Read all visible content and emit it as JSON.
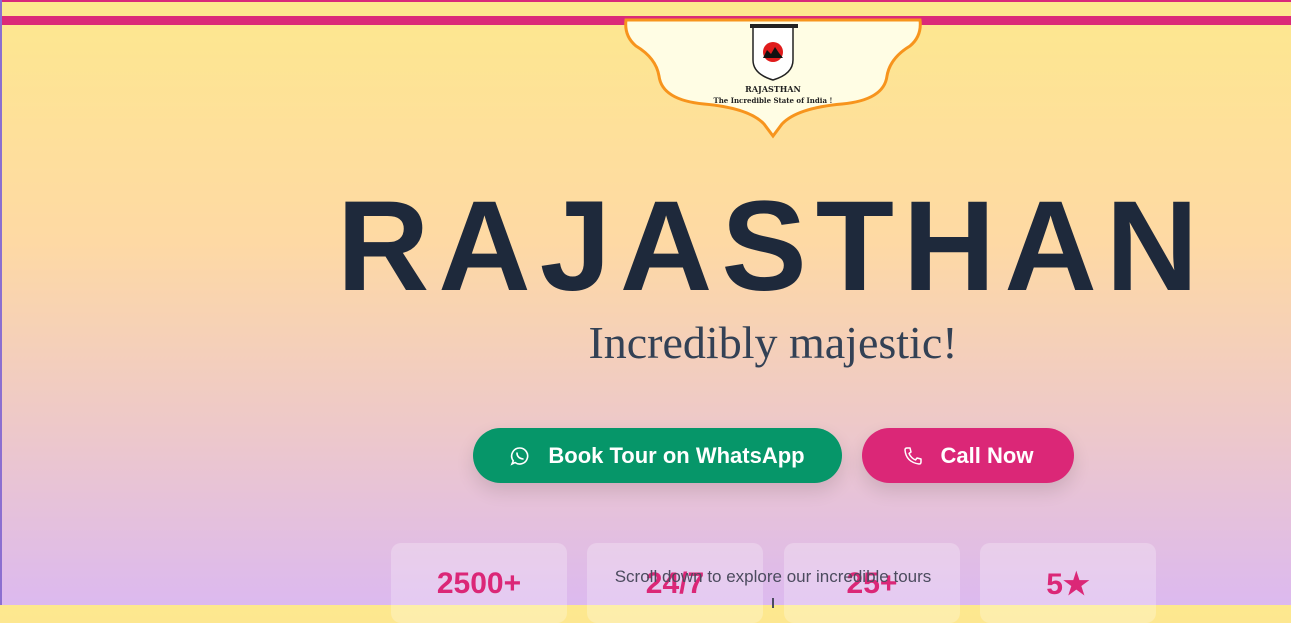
{
  "emblem": {
    "title": "RAJASTHAN",
    "tagline": "The Incredible State of India !"
  },
  "hero": {
    "title": "RAJASTHAN",
    "subtitle": "Incredibly majestic!"
  },
  "buttons": {
    "whatsapp": "Book Tour on WhatsApp",
    "call": "Call Now"
  },
  "stats": [
    "2500+",
    "24/7",
    "25+",
    "5★"
  ],
  "scroll_hint": "Scroll down to explore our incredible tours",
  "colors": {
    "accent": "#db2777",
    "whatsapp": "#069669",
    "title": "#1e293b"
  }
}
